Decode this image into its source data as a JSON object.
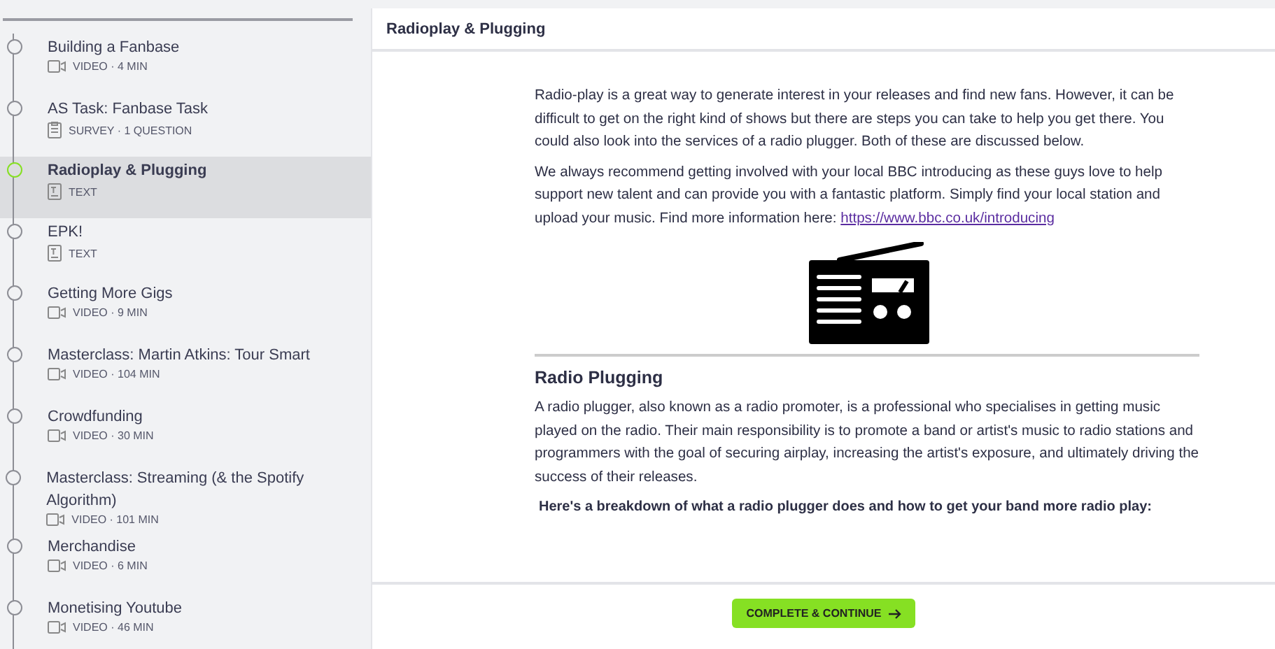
{
  "sidebar": {
    "items": [
      {
        "title": "Building a Fanbase",
        "kind": "video",
        "meta": "VIDEO · 4 MIN",
        "selected": false
      },
      {
        "title": "AS Task: Fanbase Task",
        "kind": "survey",
        "meta": "SURVEY · 1 QUESTION",
        "selected": false
      },
      {
        "title": "Radioplay & Plugging",
        "kind": "text",
        "meta": "TEXT",
        "selected": true
      },
      {
        "title": "EPK!",
        "kind": "text",
        "meta": "TEXT",
        "selected": false
      },
      {
        "title": "Getting More Gigs",
        "kind": "video",
        "meta": "VIDEO · 9 MIN",
        "selected": false
      },
      {
        "title": "Masterclass: Martin Atkins: Tour Smart",
        "kind": "video",
        "meta": "VIDEO · 104 MIN",
        "selected": false
      },
      {
        "title": "Crowdfunding",
        "kind": "video",
        "meta": "VIDEO · 30 MIN",
        "selected": false
      },
      {
        "title": "Masterclass: Streaming (& the Spotify Algorithm)",
        "kind": "video",
        "meta": "VIDEO · 101 MIN",
        "selected": false
      },
      {
        "title": "Merchandise",
        "kind": "video",
        "meta": "VIDEO · 6 MIN",
        "selected": false
      },
      {
        "title": "Monetising Youtube",
        "kind": "video",
        "meta": "VIDEO · 46 MIN",
        "selected": false
      }
    ]
  },
  "lesson": {
    "title": "Radioplay & Plugging",
    "intro": "Radio-play is a great way to generate interest in your releases and find new fans. However, it can be difficult to get on the right kind of shows but there are steps you can take to help you get there. You could also look into the services of a radio plugger. Both of these are discussed below.",
    "paragraph_2": "We always recommend getting involved with your local BBC introducing as these guys love to help support new talent and can provide you with a fantastic platform. Simply find your local station and upload your music. Find more information here:",
    "link": "https://www.bbc.co.uk/introducing",
    "heading": "Radio Plugging",
    "paragraph_3": "A radio plugger, also known as a radio promoter, is a professional who specialises in getting music played on the radio. Their main responsibility is to promote a band or artist's music to radio stations and programmers with the goal of securing airplay, increasing the artist's exposure, and ultimately driving the success of their releases.",
    "lead_in": "Here's a breakdown of what a radio plugger does and how to get your band more radio play:"
  },
  "footer": {
    "button": "COMPLETE & CONTINUE"
  }
}
